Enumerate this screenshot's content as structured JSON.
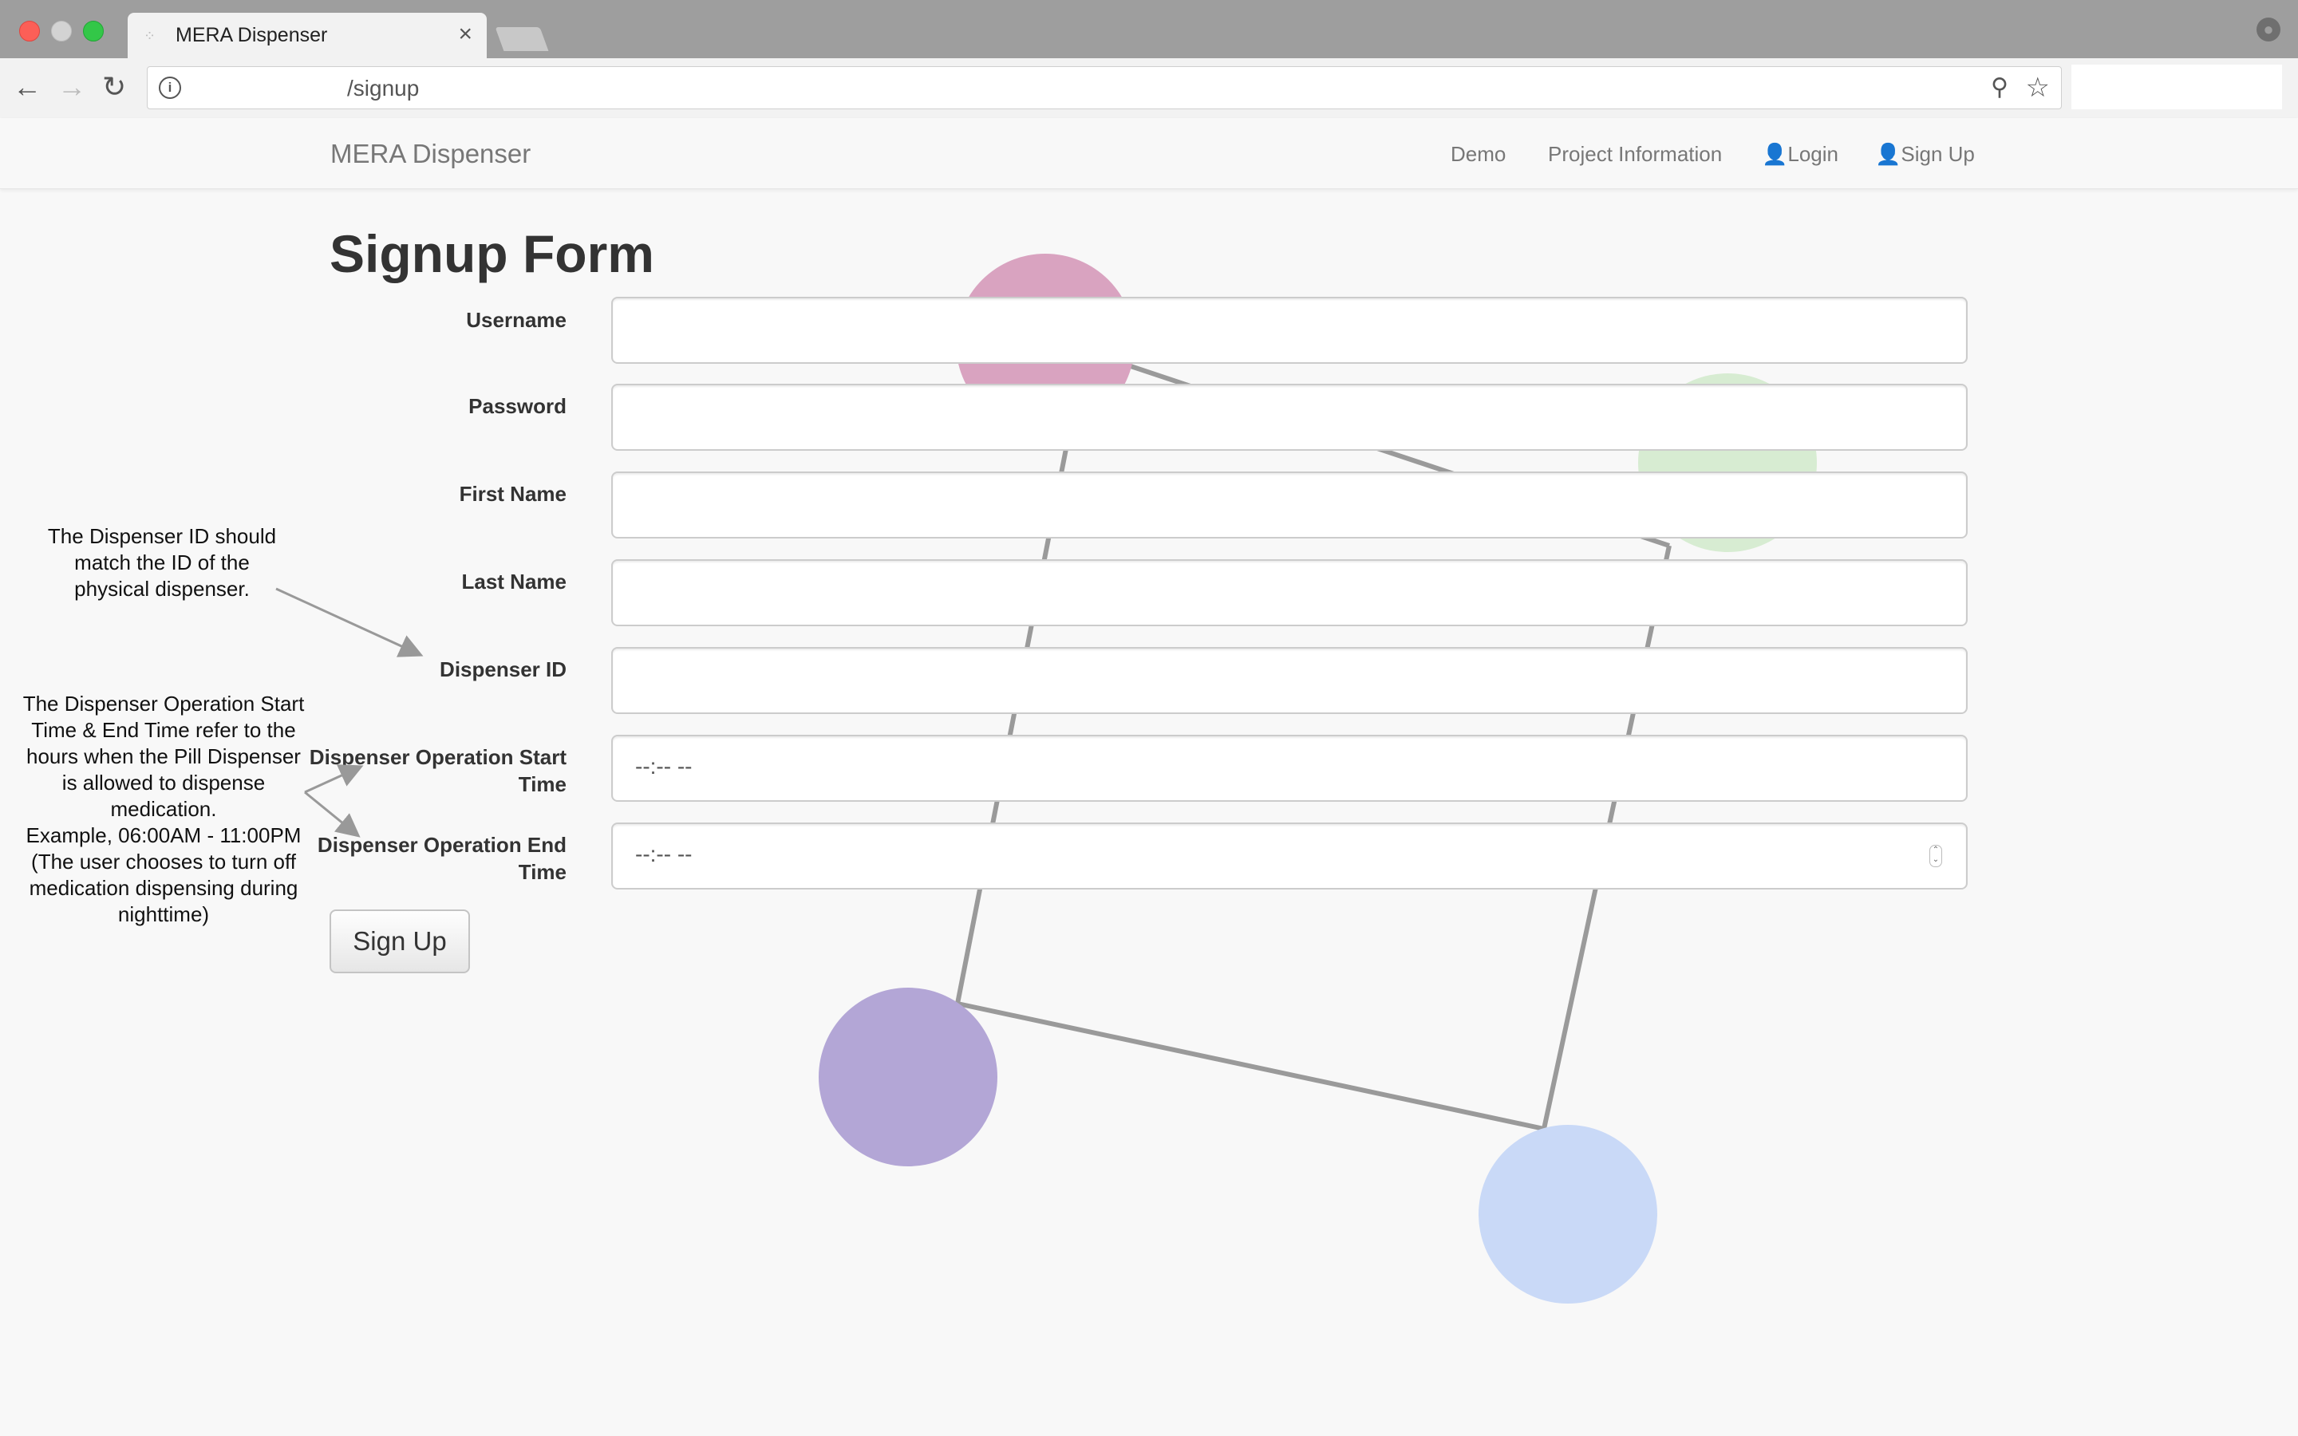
{
  "browser": {
    "tab_title": "MERA Dispenser",
    "tab_close": "×",
    "url": "/signup"
  },
  "navbar": {
    "brand": "MERA Dispenser",
    "links": [
      "Demo",
      "Project Information",
      "Login",
      "Sign Up"
    ]
  },
  "form": {
    "title": "Signup Form",
    "fields": [
      {
        "label": "Username",
        "value": ""
      },
      {
        "label": "Password",
        "value": ""
      },
      {
        "label": "First Name",
        "value": ""
      },
      {
        "label": "Last Name",
        "value": ""
      },
      {
        "label": "Dispenser ID",
        "value": ""
      },
      {
        "label": "Dispenser Operation Start Time",
        "value": "--:-- --"
      },
      {
        "label": "Dispenser Operation End Time",
        "value": "--:-- --"
      }
    ],
    "submit_label": "Sign Up"
  },
  "annotations": {
    "dispenser_id_note": "The Dispenser ID should\nmatch the ID of the\nphysical dispenser.",
    "operation_time_note": "The Dispenser Operation Start\nTime & End Time refer to the\nhours when the Pill Dispenser\nis allowed to dispense\nmedication.\nExample, 06:00AM - 11:00PM\n(The user chooses to turn off\nmedication dispensing during\nnighttime)"
  },
  "colors": {
    "circle_pink": "#d9a3c0",
    "circle_green": "#d7ecd2",
    "circle_purple": "#b3a6d6",
    "circle_blue": "#c9d9f7"
  }
}
